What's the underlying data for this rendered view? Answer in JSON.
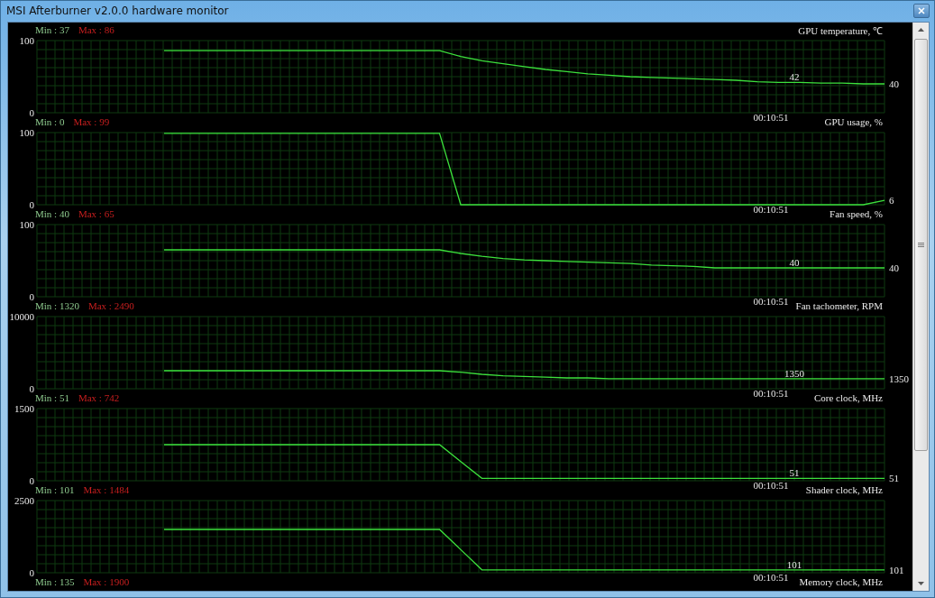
{
  "window": {
    "title": "MSI Afterburner v2.0.0 hardware monitor"
  },
  "panels": [
    {
      "min": "Min : 37",
      "max": "Max : 86",
      "title": "GPU temperature, ℃",
      "time": "00:10:51",
      "current": "40",
      "inline_value": "42",
      "chart_data": {
        "type": "line",
        "grid": true,
        "ylim": [
          0,
          100
        ],
        "yticks": [
          0,
          100
        ],
        "series": [
          {
            "color": "#3ce03c",
            "values": [
              null,
              null,
              null,
              null,
              null,
              null,
              86,
              86,
              86,
              86,
              86,
              86,
              86,
              86,
              86,
              86,
              86,
              86,
              86,
              86,
              78,
              72,
              68,
              64,
              60,
              57,
              54,
              52,
              50,
              49,
              48,
              47,
              46,
              45,
              43,
              42,
              42,
              41,
              41,
              40,
              40
            ]
          }
        ]
      }
    },
    {
      "min": "Min : 0",
      "max": "Max : 99",
      "title": "GPU usage, %",
      "time": "00:10:51",
      "current": "6",
      "chart_data": {
        "type": "line",
        "grid": true,
        "ylim": [
          0,
          100
        ],
        "yticks": [
          0,
          100
        ],
        "series": [
          {
            "color": "#3ce03c",
            "values": [
              null,
              null,
              null,
              null,
              null,
              null,
              99,
              99,
              99,
              99,
              99,
              99,
              99,
              99,
              99,
              99,
              99,
              99,
              99,
              99,
              0,
              0,
              0,
              0,
              0,
              0,
              0,
              0,
              0,
              0,
              0,
              0,
              0,
              0,
              0,
              0,
              0,
              0,
              0,
              0,
              6
            ]
          }
        ]
      }
    },
    {
      "min": "Min : 40",
      "max": "Max : 65",
      "title": "Fan speed, %",
      "time": "00:10:51",
      "current": "40",
      "inline_value": "40",
      "chart_data": {
        "type": "line",
        "grid": true,
        "ylim": [
          0,
          100
        ],
        "yticks": [
          0,
          100
        ],
        "series": [
          {
            "color": "#3ce03c",
            "values": [
              null,
              null,
              null,
              null,
              null,
              null,
              65,
              65,
              65,
              65,
              65,
              65,
              65,
              65,
              65,
              65,
              65,
              65,
              65,
              65,
              60,
              56,
              53,
              51,
              50,
              49,
              48,
              47,
              46,
              44,
              43,
              42,
              40,
              40,
              40,
              40,
              40,
              40,
              40,
              40,
              40
            ]
          }
        ]
      }
    },
    {
      "min": "Min : 1320",
      "max": "Max : 2490",
      "title": "Fan tachometer, RPM",
      "time": "00:10:51",
      "current": "1350",
      "inline_value": "1350",
      "chart_data": {
        "type": "line",
        "grid": true,
        "ylim": [
          0,
          10000
        ],
        "yticks": [
          0,
          10000
        ],
        "series": [
          {
            "color": "#3ce03c",
            "values": [
              null,
              null,
              null,
              null,
              null,
              null,
              2500,
              2500,
              2500,
              2500,
              2500,
              2500,
              2500,
              2500,
              2500,
              2500,
              2500,
              2500,
              2500,
              2500,
              2300,
              2000,
              1800,
              1700,
              1600,
              1500,
              1500,
              1400,
              1400,
              1400,
              1400,
              1400,
              1400,
              1400,
              1400,
              1400,
              1400,
              1400,
              1400,
              1400,
              1400
            ]
          }
        ]
      }
    },
    {
      "min": "Min : 51",
      "max": "Max : 742",
      "title": "Core clock, MHz",
      "time": "00:10:51",
      "current": "51",
      "inline_value": "51",
      "chart_data": {
        "type": "line",
        "grid": true,
        "ylim": [
          0,
          1500
        ],
        "yticks": [
          0,
          1500
        ],
        "series": [
          {
            "color": "#3ce03c",
            "values": [
              null,
              null,
              null,
              null,
              null,
              null,
              750,
              750,
              750,
              750,
              750,
              750,
              750,
              750,
              750,
              750,
              750,
              750,
              750,
              750,
              400,
              50,
              50,
              50,
              50,
              50,
              50,
              50,
              50,
              50,
              50,
              50,
              50,
              50,
              50,
              50,
              50,
              50,
              50,
              50,
              50
            ]
          }
        ]
      }
    },
    {
      "min": "Min : 101",
      "max": "Max : 1484",
      "title": "Shader clock, MHz",
      "time": "00:10:51",
      "current": "101",
      "inline_value": "101",
      "chart_data": {
        "type": "line",
        "grid": true,
        "ylim": [
          0,
          2500
        ],
        "yticks": [
          0,
          2500
        ],
        "series": [
          {
            "color": "#3ce03c",
            "values": [
              null,
              null,
              null,
              null,
              null,
              null,
              1500,
              1500,
              1500,
              1500,
              1500,
              1500,
              1500,
              1500,
              1500,
              1500,
              1500,
              1500,
              1500,
              1500,
              800,
              100,
              100,
              100,
              100,
              100,
              100,
              100,
              100,
              100,
              100,
              100,
              100,
              100,
              100,
              100,
              100,
              100,
              100,
              100,
              100
            ]
          }
        ]
      }
    },
    {
      "min": "Min : 135",
      "max": "Max : 1900",
      "title": "Memory clock, MHz"
    }
  ]
}
